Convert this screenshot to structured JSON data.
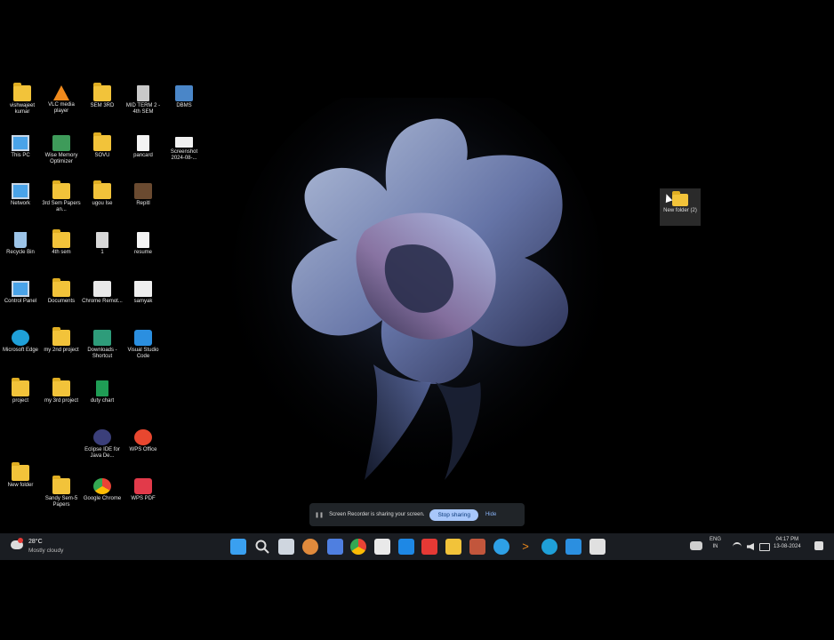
{
  "desktop_icons": {
    "c1": [
      "vishwajeet kumar",
      "This PC",
      "Network",
      "Recycle Bin",
      "Control Panel",
      "Microsoft Edge",
      "project",
      "New folder"
    ],
    "c2": [
      "VLC media player",
      "Wise Memory Optimizer",
      "3rd Sem Papers an...",
      "4th sem",
      "Documents",
      "my 2nd project",
      "my 3rd project",
      "Sandy Sem-5 Papers"
    ],
    "c3": [
      "SEM 3RD",
      "SOVU",
      "ugou Ise",
      "1",
      "Chrome Remot...",
      "Downloads - Shortcut",
      "duty chart",
      "Eclipse IDE for Java De...",
      "Google Chrome"
    ],
    "c4": [
      "MID TERM 2 - 4th SEM",
      "pancard",
      "Repitl",
      "resume",
      "samyak",
      "Visual Studio Code",
      "WPS Office",
      "WPS PDF"
    ],
    "c5": [
      "DBMS",
      "Screenshot 2024-08-..."
    ]
  },
  "dragged_folder": "New folder (2)",
  "share_bar": {
    "message": "Screen Recorder is sharing your screen.",
    "stop_label": "Stop sharing",
    "hide_label": "Hide"
  },
  "weather": {
    "temp": "28°C",
    "condition": "Mostly cloudy"
  },
  "tray": {
    "lang_line1": "ENG",
    "lang_line2": "IN",
    "time": "04:17 PM",
    "date": "13-08-2024"
  },
  "colors": {
    "taskbar": "#1a1d22",
    "accent": "#a8c7fa"
  }
}
